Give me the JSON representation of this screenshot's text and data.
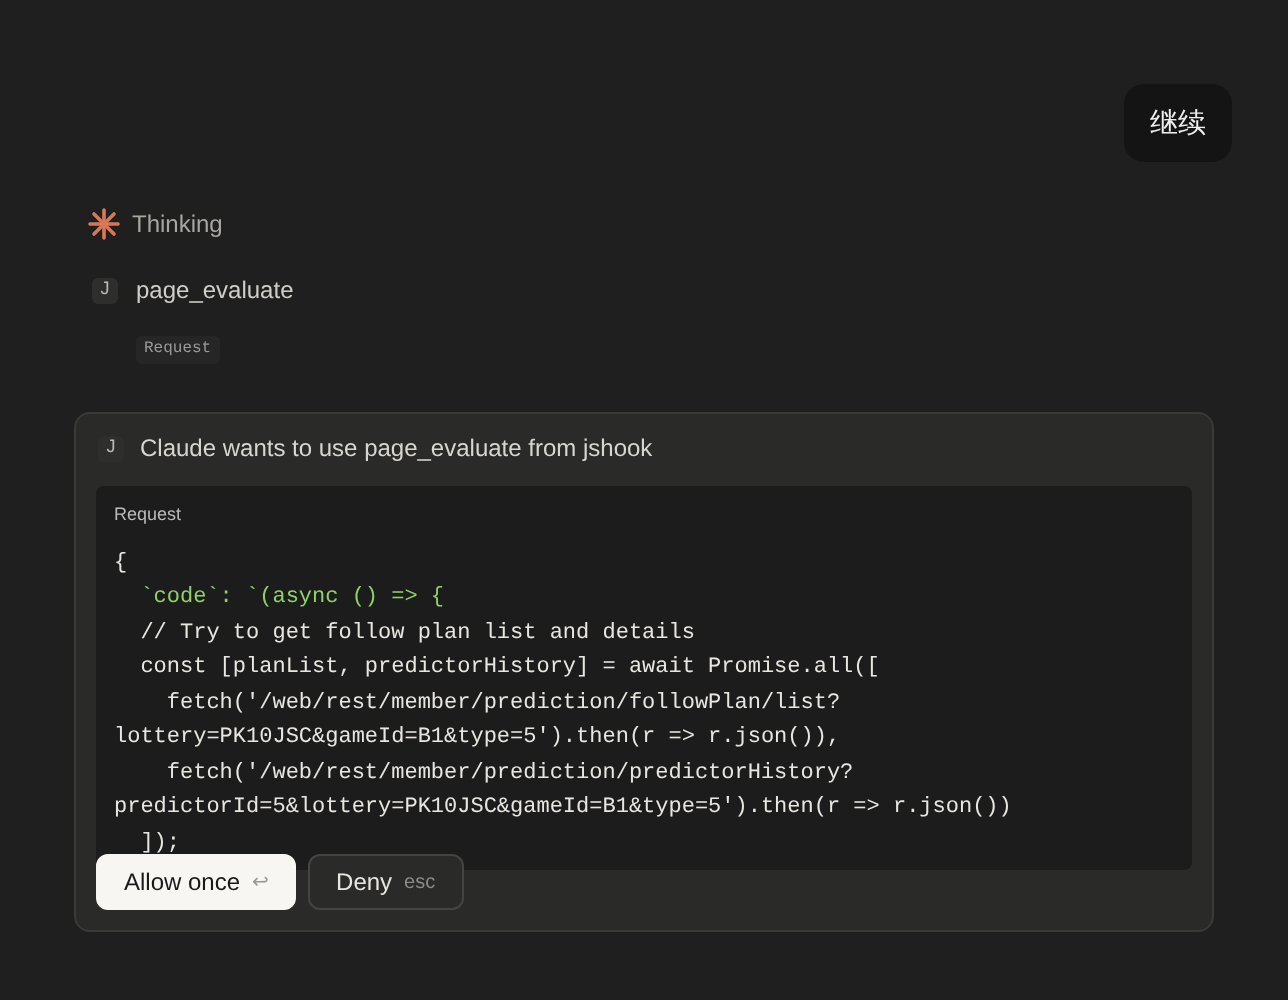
{
  "user_message": {
    "text": "继续"
  },
  "thinking": {
    "label": "Thinking"
  },
  "tool_call": {
    "badge": "J",
    "name": "page_evaluate",
    "tag": "Request"
  },
  "permission": {
    "badge": "J",
    "title": "Claude wants to use page_evaluate from jshook",
    "section_label": "Request",
    "code_lines": [
      {
        "kind": "plain",
        "text": "{"
      },
      {
        "kind": "string",
        "text": "  `code`: `(async () => {"
      },
      {
        "kind": "plain",
        "text": "  // Try to get follow plan list and details"
      },
      {
        "kind": "plain",
        "text": "  const [planList, predictorHistory] = await Promise.all(["
      },
      {
        "kind": "plain",
        "text": "    fetch('/web/rest/member/prediction/followPlan/list?"
      },
      {
        "kind": "plain",
        "text": "lottery=PK10JSC&gameId=B1&type=5').then(r => r.json()),"
      },
      {
        "kind": "plain",
        "text": "    fetch('/web/rest/member/prediction/predictorHistory?"
      },
      {
        "kind": "plain",
        "text": "predictorId=5&lottery=PK10JSC&gameId=B1&type=5').then(r => r.json())"
      },
      {
        "kind": "plain",
        "text": "  ]);"
      }
    ],
    "buttons": [
      {
        "kind": "primary",
        "label": "Allow once",
        "hint": "↩"
      },
      {
        "kind": "secondary",
        "label": "Deny",
        "hint": "esc"
      }
    ]
  }
}
